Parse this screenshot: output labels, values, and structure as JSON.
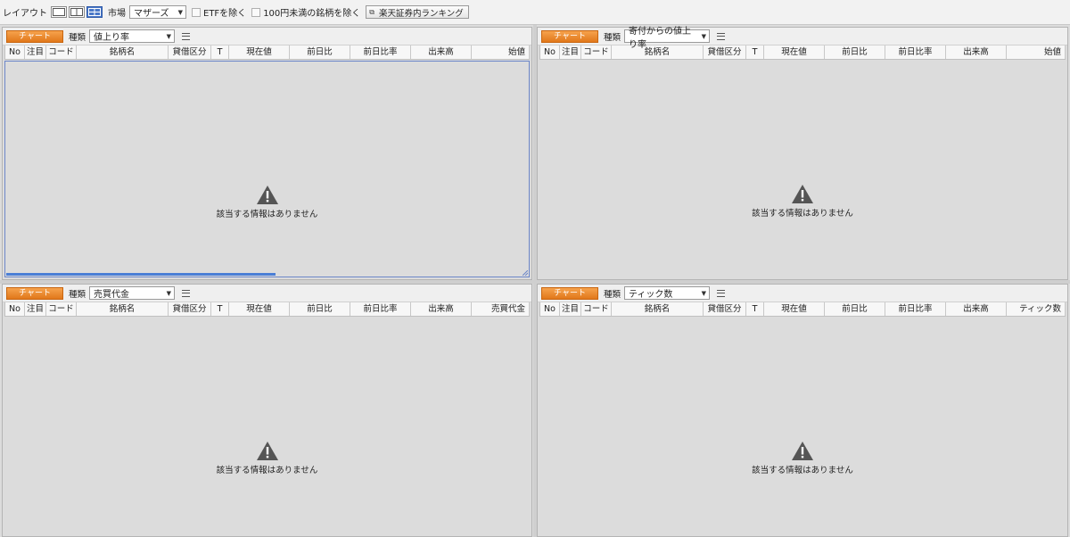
{
  "toolbar": {
    "layout_label": "レイアウト",
    "market_label": "市場",
    "market_value": "マザーズ",
    "etf_label": "ETFを除く",
    "under100_label": "100円未満の銘柄を除く",
    "ranking_button": "楽天証券内ランキング"
  },
  "panels": [
    {
      "chart_label": "チャート",
      "kind_label": "種類",
      "kind_value": "値上り率",
      "columns": [
        "No",
        "注目",
        "コード",
        "銘柄名",
        "貸借区分",
        "T",
        "現在値",
        "前日比",
        "前日比率",
        "出来高",
        "始値"
      ],
      "empty_message": "該当する情報はありません"
    },
    {
      "chart_label": "チャート",
      "kind_label": "種類",
      "kind_value": "寄付からの値上り率",
      "columns": [
        "No",
        "注目",
        "コード",
        "銘柄名",
        "貸借区分",
        "T",
        "現在値",
        "前日比",
        "前日比率",
        "出来高",
        "始値"
      ],
      "empty_message": "該当する情報はありません"
    },
    {
      "chart_label": "チャート",
      "kind_label": "種類",
      "kind_value": "売買代金",
      "columns": [
        "No",
        "注目",
        "コード",
        "銘柄名",
        "貸借区分",
        "T",
        "現在値",
        "前日比",
        "前日比率",
        "出来高",
        "売買代金"
      ],
      "empty_message": "該当する情報はありません"
    },
    {
      "chart_label": "チャート",
      "kind_label": "種類",
      "kind_value": "ティック数",
      "columns": [
        "No",
        "注目",
        "コード",
        "銘柄名",
        "貸借区分",
        "T",
        "現在値",
        "前日比",
        "前日比率",
        "出来高",
        "ティック数"
      ],
      "empty_message": "該当する情報はありません"
    }
  ],
  "icons": {
    "warning": "warning-icon",
    "menu": "hamburger-menu-icon",
    "external": "external-link-icon"
  },
  "colors": {
    "chart_button": "#e8841f",
    "layout_active": "#4a78c8",
    "selection": "#6b86c8"
  }
}
